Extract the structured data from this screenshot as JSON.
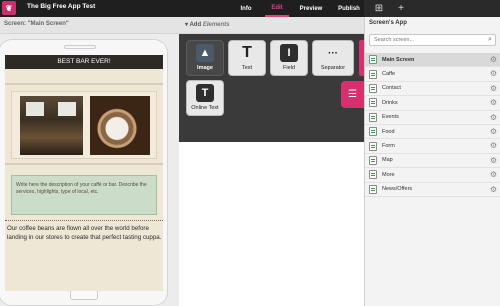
{
  "app": {
    "title": "The Big Free App Test",
    "tabs": [
      {
        "label": "Info",
        "active": false
      },
      {
        "label": "Edit",
        "active": true
      },
      {
        "label": "Preview",
        "active": false
      },
      {
        "label": "Publish",
        "active": false
      }
    ],
    "accent_color": "#d8306e"
  },
  "screen": {
    "label": "Screen: \"Main Screen\""
  },
  "phone": {
    "bar_title": "BEST BAR EVER!",
    "description": "Write here the description of your caffé or bar. Describe the services, highlights, type of local, etc.",
    "body_text": "Our coffee beans are flown all over the world before landing in our stores to create that perfect tasting cuppa."
  },
  "elements": {
    "add_label": "Add",
    "add_label_em": "Elements",
    "tiles": [
      {
        "label": "Image",
        "icon": "image-icon",
        "glyph": "▲",
        "active": true
      },
      {
        "label": "Text",
        "icon": "text-icon",
        "glyph": "T",
        "active": false
      },
      {
        "label": "Field",
        "icon": "field-icon",
        "glyph": "I",
        "active": false
      },
      {
        "label": "Separator",
        "icon": "separator-icon",
        "glyph": "···",
        "active": false
      },
      {
        "label": "Online Text",
        "icon": "online-text-icon",
        "glyph": "T",
        "active": false
      }
    ]
  },
  "right_panel": {
    "title": "Screen's App",
    "search_placeholder": "Search screen...",
    "screens": [
      {
        "label": "Main Screen",
        "selected": true
      },
      {
        "label": "Caffe",
        "selected": false
      },
      {
        "label": "Contact",
        "selected": false
      },
      {
        "label": "Drinks",
        "selected": false
      },
      {
        "label": "Events",
        "selected": false
      },
      {
        "label": "Food",
        "selected": false
      },
      {
        "label": "Form",
        "selected": false
      },
      {
        "label": "Map",
        "selected": false
      },
      {
        "label": "More",
        "selected": false
      },
      {
        "label": "News/Offers",
        "selected": false
      }
    ]
  }
}
